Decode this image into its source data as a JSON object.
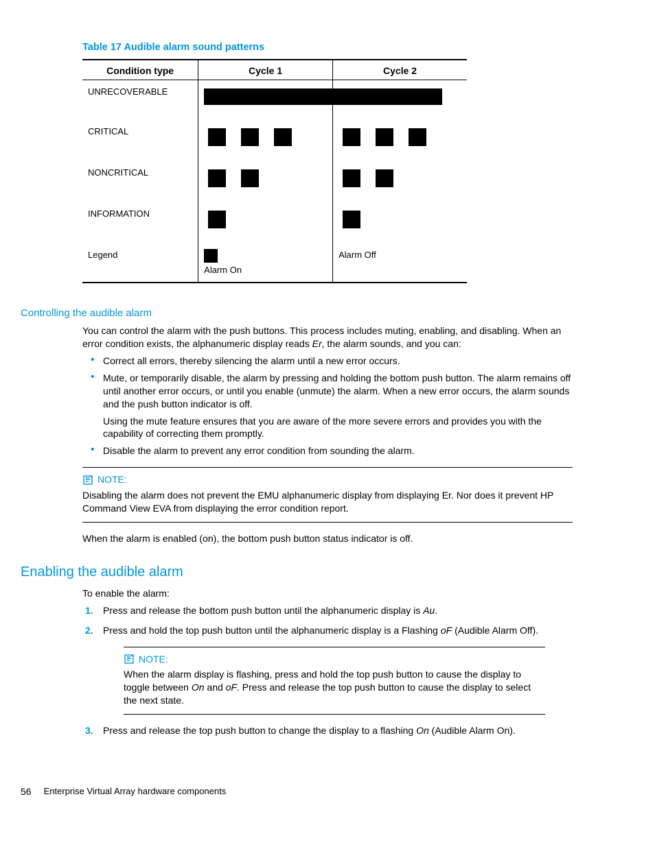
{
  "tableTitle": "Table 17 Audible alarm sound patterns",
  "headers": {
    "condition": "Condition type",
    "c1": "Cycle 1",
    "c2": "Cycle 2"
  },
  "rows": {
    "unrecoverable": "UNRECOVERABLE",
    "critical": "CRITICAL",
    "noncritical": "NONCRITICAL",
    "information": "INFORMATION",
    "legend": "Legend",
    "alarmOn": "Alarm On",
    "alarmOff": "Alarm Off"
  },
  "sub1": "Controlling the audible alarm",
  "p1a": "You can control the alarm with the push buttons. This process includes muting, enabling, and disabling. When an error condition exists, the alphanumeric display reads ",
  "p1b": ", the alarm sounds, and you can:",
  "er": "Er",
  "b1": "Correct all errors, thereby silencing the alarm until a new error occurs.",
  "b2": "Mute, or temporarily disable, the alarm by pressing and holding the bottom push button. The alarm remains off until another error occurs, or until you enable (unmute) the alarm. When a new error occurs, the alarm sounds and the push button indicator is off.",
  "b2a": "Using the mute feature ensures that you are aware of the more severe errors and provides you with the capability of correcting them promptly.",
  "b3": "Disable the alarm to prevent any error condition from sounding the alarm.",
  "noteLabel": "NOTE:",
  "note1": "Disabling the alarm does not prevent the EMU alphanumeric display from displaying Er. Nor does it prevent HP Command View EVA from displaying the error condition report.",
  "p2": "When the alarm is enabled (on), the bottom push button status indicator is off.",
  "h2": "Enabling the audible alarm",
  "p3": "To enable the alarm:",
  "s1a": "Press and release the bottom push button until the alphanumeric display is ",
  "au": "Au",
  "s1b": ".",
  "s2a": "Press and hold the top push button until the alphanumeric display is a Flashing ",
  "oF": "oF",
  "s2b": " (Audible Alarm Off).",
  "note2a": "When the alarm display is flashing, press and hold the top push button to cause the display to toggle between ",
  "on": "On",
  "note2b": " and ",
  "note2c": ". Press and release the top push button to cause the display to select the next state.",
  "s3a": "Press and release the top push button to change the display to a flashing ",
  "s3b": " (Audible Alarm On).",
  "footer": {
    "page": "56",
    "title": "Enterprise Virtual Array hardware components"
  }
}
